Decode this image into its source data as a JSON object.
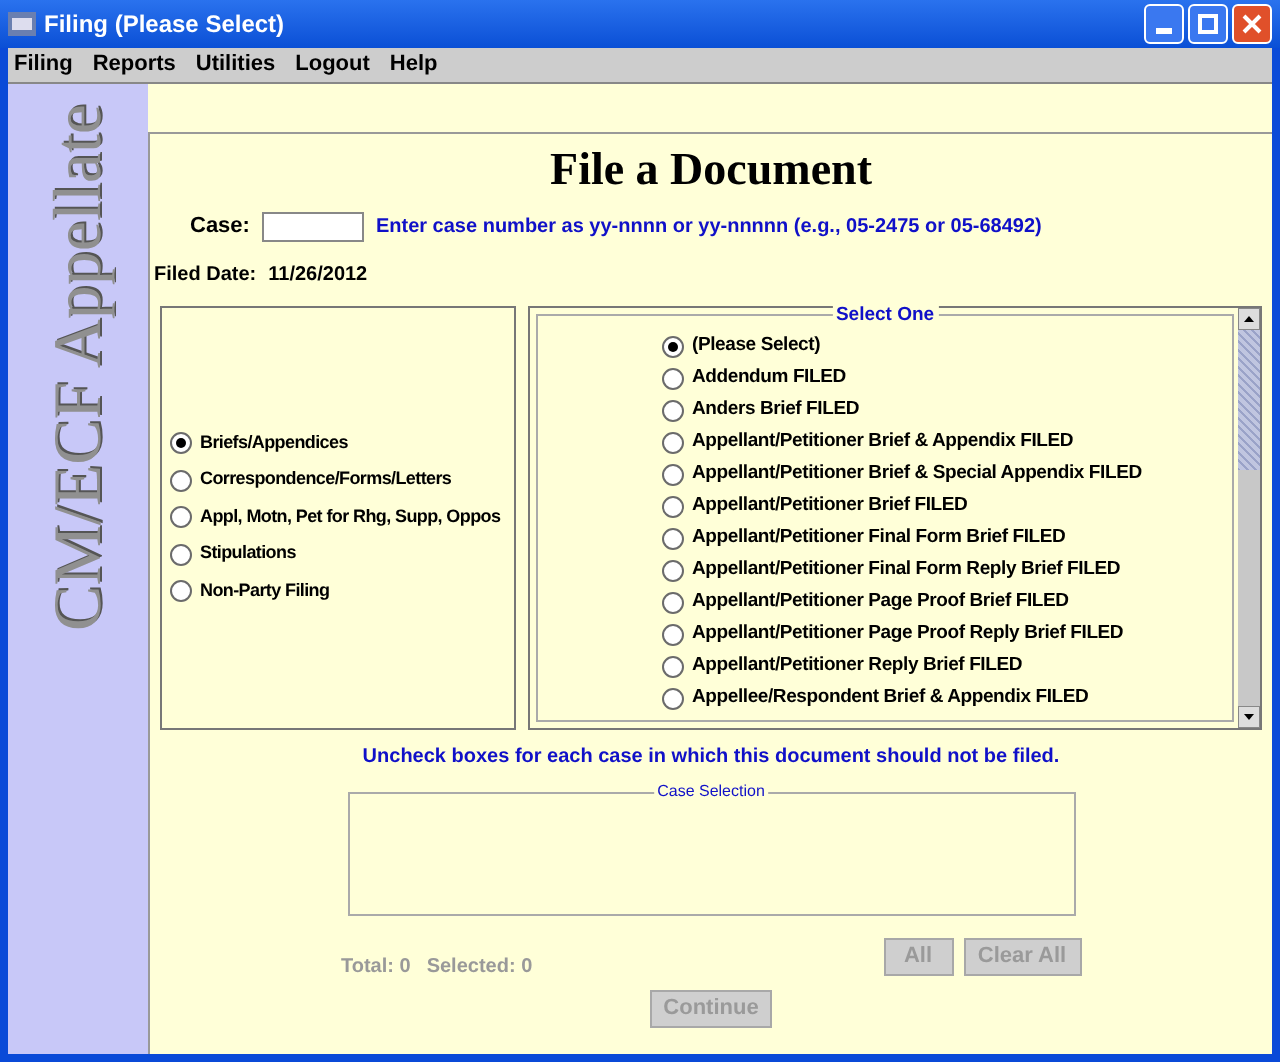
{
  "window": {
    "title": "Filing (Please Select)"
  },
  "menu": [
    "Filing",
    "Reports",
    "Utilities",
    "Logout",
    "Help"
  ],
  "sidebar": {
    "brand": "CM/ECF Appellate"
  },
  "heading": "File a Document",
  "case": {
    "label": "Case:",
    "hint": "Enter case number as yy-nnnn or yy-nnnnn (e.g., 05-2475 or 05-68492)"
  },
  "filed_date": {
    "label": "Filed Date:",
    "value": "11/26/2012"
  },
  "categories": [
    {
      "label": "Briefs/Appendices",
      "selected": true
    },
    {
      "label": "Correspondence/Forms/Letters",
      "selected": false
    },
    {
      "label": "Appl, Motn, Pet for Rhg, Supp, Oppos",
      "selected": false
    },
    {
      "label": "Stipulations",
      "selected": false
    },
    {
      "label": "Non-Party Filing",
      "selected": false
    }
  ],
  "events": {
    "title": "Select One",
    "items": [
      {
        "label": "(Please Select)",
        "selected": true
      },
      {
        "label": "Addendum FILED",
        "selected": false
      },
      {
        "label": "Anders Brief FILED",
        "selected": false
      },
      {
        "label": "Appellant/Petitioner Brief & Appendix FILED",
        "selected": false
      },
      {
        "label": "Appellant/Petitioner Brief & Special Appendix FILED",
        "selected": false
      },
      {
        "label": "Appellant/Petitioner Brief FILED",
        "selected": false
      },
      {
        "label": "Appellant/Petitioner Final Form Brief FILED",
        "selected": false
      },
      {
        "label": "Appellant/Petitioner Final Form Reply Brief FILED",
        "selected": false
      },
      {
        "label": "Appellant/Petitioner Page Proof Brief FILED",
        "selected": false
      },
      {
        "label": "Appellant/Petitioner Page Proof Reply Brief FILED",
        "selected": false
      },
      {
        "label": "Appellant/Petitioner Reply Brief FILED",
        "selected": false
      },
      {
        "label": "Appellee/Respondent Brief & Appendix FILED",
        "selected": false
      }
    ]
  },
  "instruction": "Uncheck boxes for each case in which this document should not be filed.",
  "case_selection": {
    "title": "Case Selection"
  },
  "total": "Total: 0",
  "selected_count": "Selected: 0",
  "buttons": [
    {
      "label": "All",
      "disabled": true
    },
    {
      "label": "Clear All",
      "disabled": true
    }
  ],
  "continue": {
    "label": "Continue",
    "disabled": true
  }
}
